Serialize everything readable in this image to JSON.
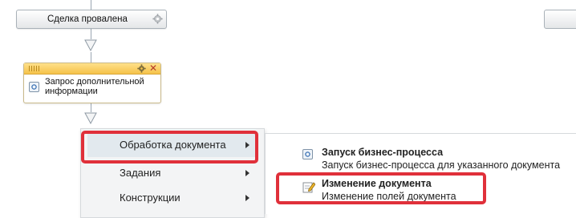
{
  "blocks": {
    "deal_failed": {
      "label": "Сделка провалена"
    },
    "request_info": {
      "label_line1": "Запрос дополнительной",
      "label_line2": "информации"
    }
  },
  "context_menu": {
    "items": [
      {
        "label": "Обработка документа",
        "has_submenu": true,
        "active": true
      },
      {
        "label": "Задания",
        "has_submenu": true,
        "active": false
      },
      {
        "label": "Конструкции",
        "has_submenu": true,
        "active": false
      }
    ]
  },
  "submenu": {
    "items": [
      {
        "title": "Запуск бизнес-процесса",
        "description": "Запуск бизнес-процесса для указанного документа",
        "icon": "process-icon"
      },
      {
        "title": "Изменение документа",
        "description": "Изменение полей документа",
        "icon": "edit-document-icon"
      }
    ]
  },
  "colors": {
    "highlight": "#e0303a",
    "connector": "#9aa6b2",
    "block_header": "#f5c24a"
  }
}
